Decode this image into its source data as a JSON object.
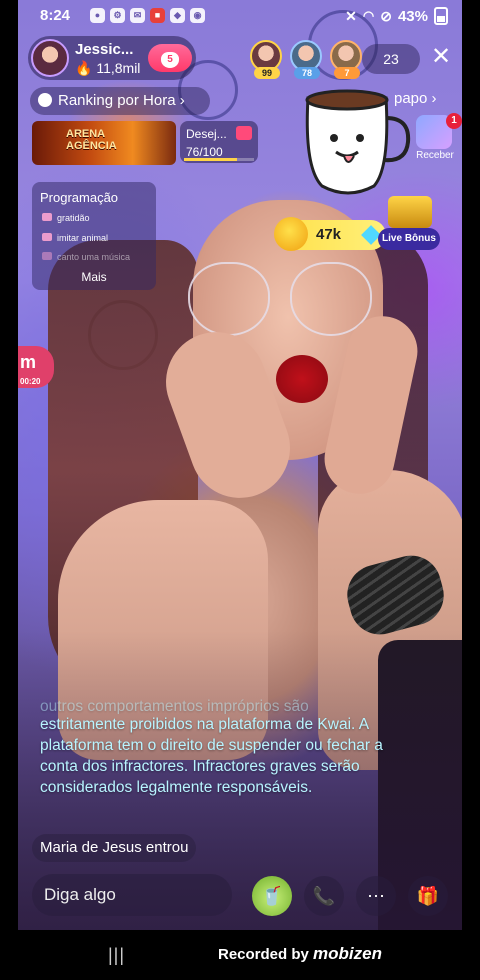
{
  "status_bar": {
    "time": "8:24",
    "battery": "43%",
    "left_icons": [
      "chat-icon",
      "settings-icon",
      "mail-icon",
      "app-icon",
      "messenger-icon",
      "camera-icon"
    ]
  },
  "host": {
    "name": "Jessic...",
    "likes": "11,8mil",
    "follow_level": "5"
  },
  "viewers": [
    {
      "level": "99",
      "color": "#ffd447"
    },
    {
      "level": "78",
      "color": "#9ac8ff"
    },
    {
      "level": "7",
      "color": "#ffb36a"
    }
  ],
  "viewer_count": "23",
  "ranking": {
    "label": "Ranking por Hora"
  },
  "papo": {
    "label": "papo"
  },
  "arena": {
    "line1": "ARENA",
    "line2": "AGÊNCIA"
  },
  "desejo": {
    "label": "Desej...",
    "progress": "76/100",
    "progress_fraction": 0.76
  },
  "receber": {
    "label": "Receber",
    "badge": "1"
  },
  "programacao": {
    "title": "Programação",
    "items": [
      "gratidão",
      "imitar animal",
      "canto uma música"
    ],
    "more_label": "Mais"
  },
  "coins": {
    "value": "47k"
  },
  "live_bonus": {
    "label": "Live Bônus"
  },
  "side_logo": {
    "text": "m",
    "sub": "00:20"
  },
  "notice": {
    "faded_line": "outros comportamentos impróprios são",
    "text": "estritamente proibidos na plataforma de Kwai. A plataforma tem o direito de suspender ou fechar a conta dos infractores. Infractores graves serão considerados legalmente responsáveis."
  },
  "join_message": "Maria de Jesus entrou",
  "input": {
    "placeholder": "Diga algo"
  },
  "bottom_actions": [
    "cup-gift-icon",
    "phone-call-icon",
    "more-icon",
    "gift-icon"
  ],
  "recorder": {
    "text": "Recorded by",
    "brand": "mobizen"
  },
  "nav": {
    "recent_apps": "|||"
  }
}
